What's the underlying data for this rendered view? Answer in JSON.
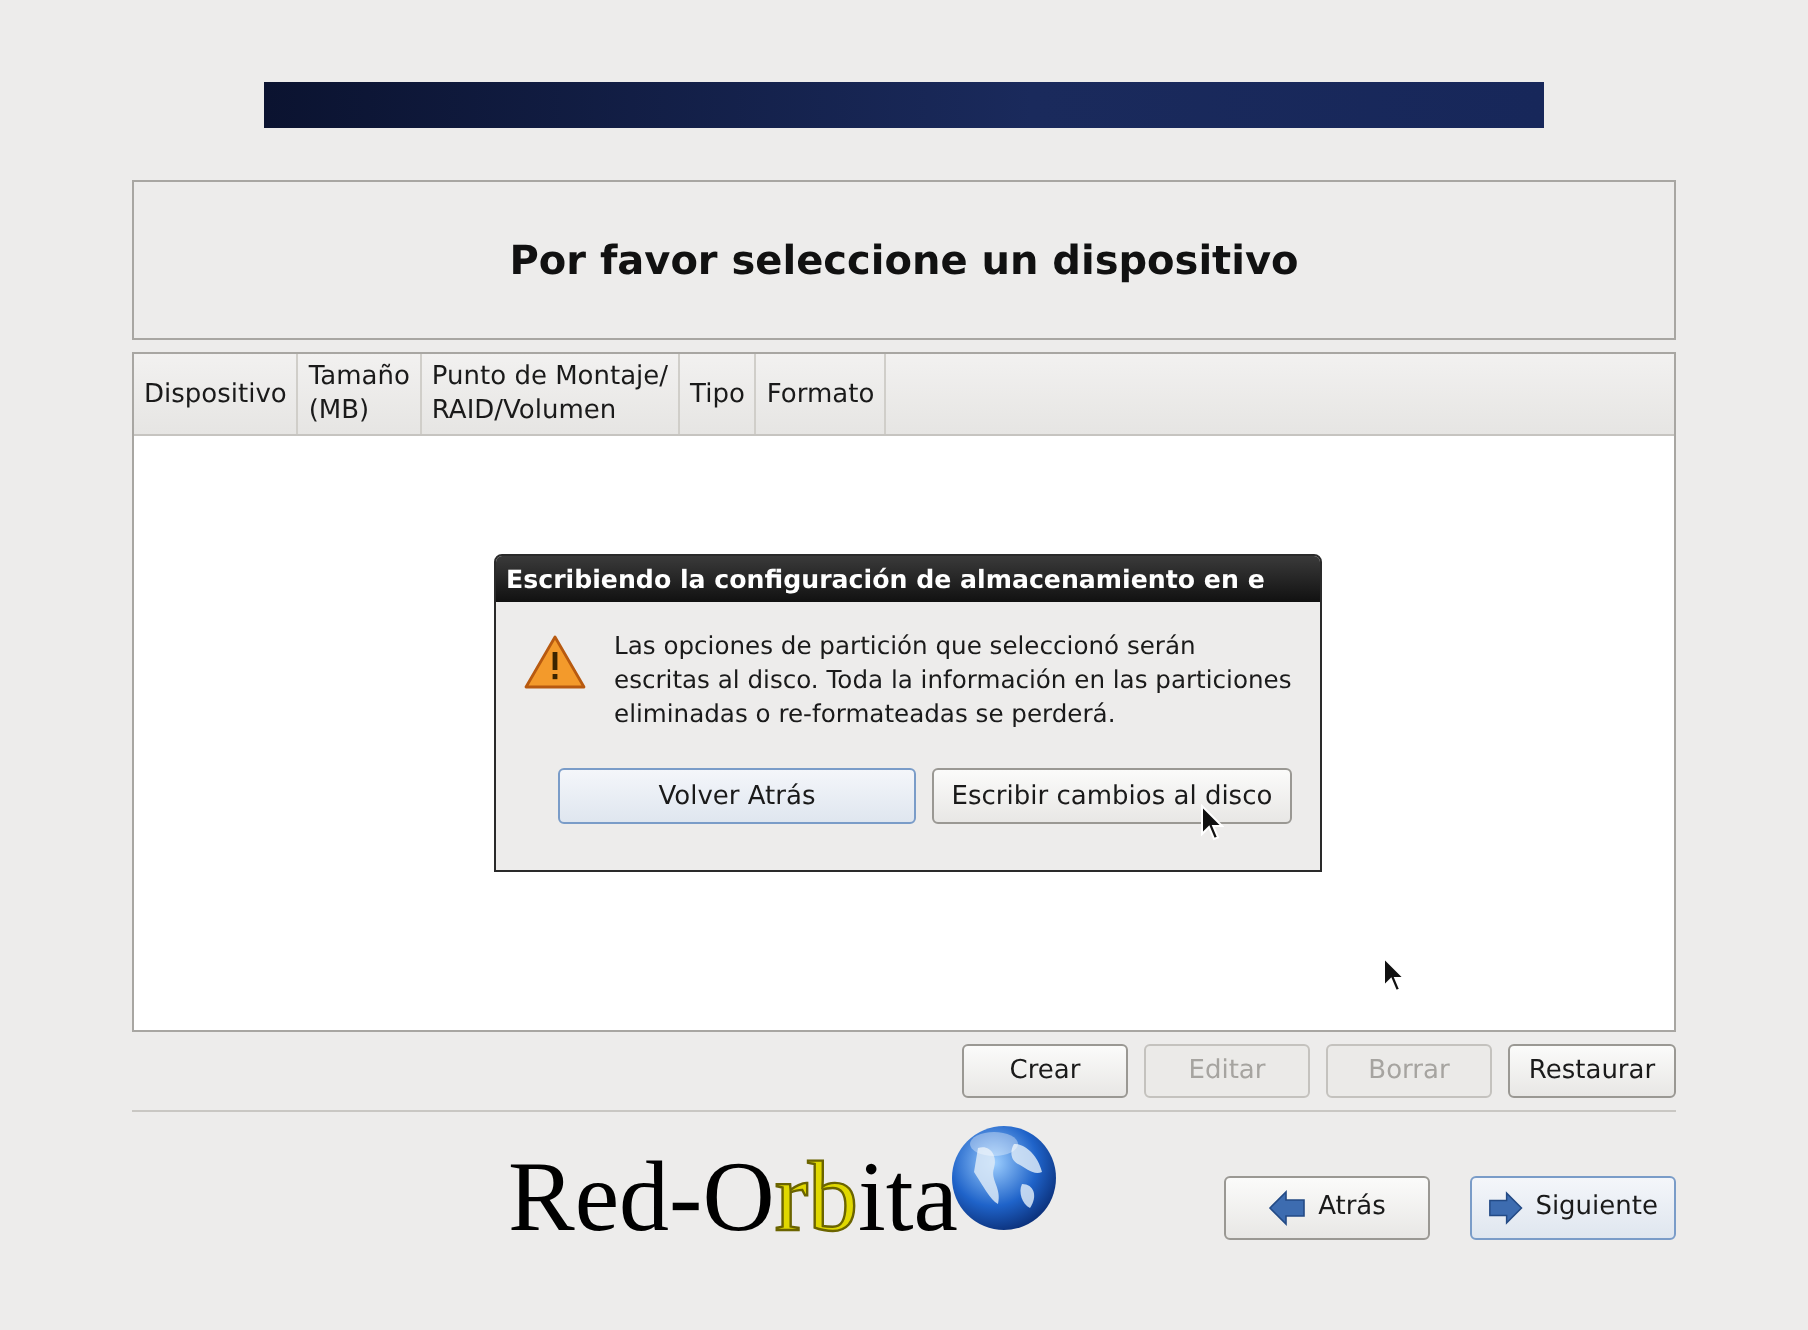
{
  "header": {
    "title": "Por favor seleccione un dispositivo"
  },
  "table": {
    "columns": [
      {
        "label": "Dispositivo"
      },
      {
        "label": "Tamaño\n(MB)"
      },
      {
        "label": "Punto de Montaje/\nRAID/Volumen"
      },
      {
        "label": "Tipo"
      },
      {
        "label": "Formato"
      }
    ]
  },
  "dialog": {
    "title": "Escribiendo la configuración de almacenamiento en e",
    "message": "Las opciones de partición que seleccionó serán escritas al disco. Toda la información en las particiones eliminadas o re-formateadas se perderá.",
    "buttons": [
      {
        "label": "Volver Atrás",
        "focused": true
      },
      {
        "label": "Escribir cambios al disco",
        "focused": false
      }
    ]
  },
  "actions": [
    {
      "label": "Crear",
      "disabled": false
    },
    {
      "label": "Editar",
      "disabled": true
    },
    {
      "label": "Borrar",
      "disabled": true
    },
    {
      "label": "Restaurar",
      "disabled": false
    }
  ],
  "logo": {
    "parts": [
      {
        "text": "Red-O",
        "highlight": false
      },
      {
        "text": "rb",
        "highlight": true
      },
      {
        "text": "ita",
        "highlight": false
      }
    ]
  },
  "navigation": [
    {
      "label": "Atrás",
      "kind": "back",
      "focused": false
    },
    {
      "label": "Siguiente",
      "kind": "next",
      "focused": true
    }
  ]
}
